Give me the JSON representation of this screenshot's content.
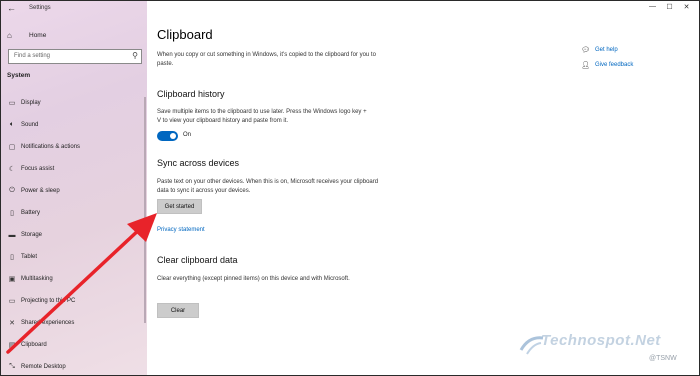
{
  "window": {
    "title": "Settings",
    "back_glyph": "←",
    "controls": [
      "—",
      "☐",
      "✕"
    ]
  },
  "sidebar": {
    "home": {
      "icon": "home-icon",
      "label": "Home"
    },
    "search": {
      "placeholder": "Find a setting"
    },
    "section": "System",
    "items": [
      {
        "icon": "display-icon",
        "label": "Display"
      },
      {
        "icon": "sound-icon",
        "label": "Sound"
      },
      {
        "icon": "notifications-icon",
        "label": "Notifications & actions"
      },
      {
        "icon": "focus-assist-icon",
        "label": "Focus assist"
      },
      {
        "icon": "power-icon",
        "label": "Power & sleep"
      },
      {
        "icon": "battery-icon",
        "label": "Battery"
      },
      {
        "icon": "storage-icon",
        "label": "Storage"
      },
      {
        "icon": "tablet-icon",
        "label": "Tablet"
      },
      {
        "icon": "multitasking-icon",
        "label": "Multitasking"
      },
      {
        "icon": "projecting-icon",
        "label": "Projecting to this PC"
      },
      {
        "icon": "shared-experiences-icon",
        "label": "Shared experiences"
      },
      {
        "icon": "clipboard-icon",
        "label": "Clipboard"
      },
      {
        "icon": "remote-desktop-icon",
        "label": "Remote Desktop"
      }
    ]
  },
  "main": {
    "title": "Clipboard",
    "intro": "When you copy or cut something in Windows, it's copied to the clipboard for you to paste.",
    "history": {
      "heading": "Clipboard history",
      "desc": "Save multiple items to the clipboard to use later. Press the Windows logo key + V to view your clipboard history and paste from it.",
      "toggle_state": "On"
    },
    "sync": {
      "heading": "Sync across devices",
      "desc": "Paste text on your other devices. When this is on, Microsoft receives your clipboard data to sync it across your devices.",
      "button": "Get started",
      "link": "Privacy statement"
    },
    "clear": {
      "heading": "Clear clipboard data",
      "desc": "Clear everything (except pinned items) on this device and with Microsoft.",
      "button": "Clear"
    },
    "help": {
      "get_help": "Get help",
      "feedback": "Give feedback"
    }
  },
  "watermark": {
    "brand": "Technospot.Net",
    "handle": "@TSNW"
  },
  "colors": {
    "accent": "#0067c0",
    "annotation_arrow": "#e8232a"
  }
}
